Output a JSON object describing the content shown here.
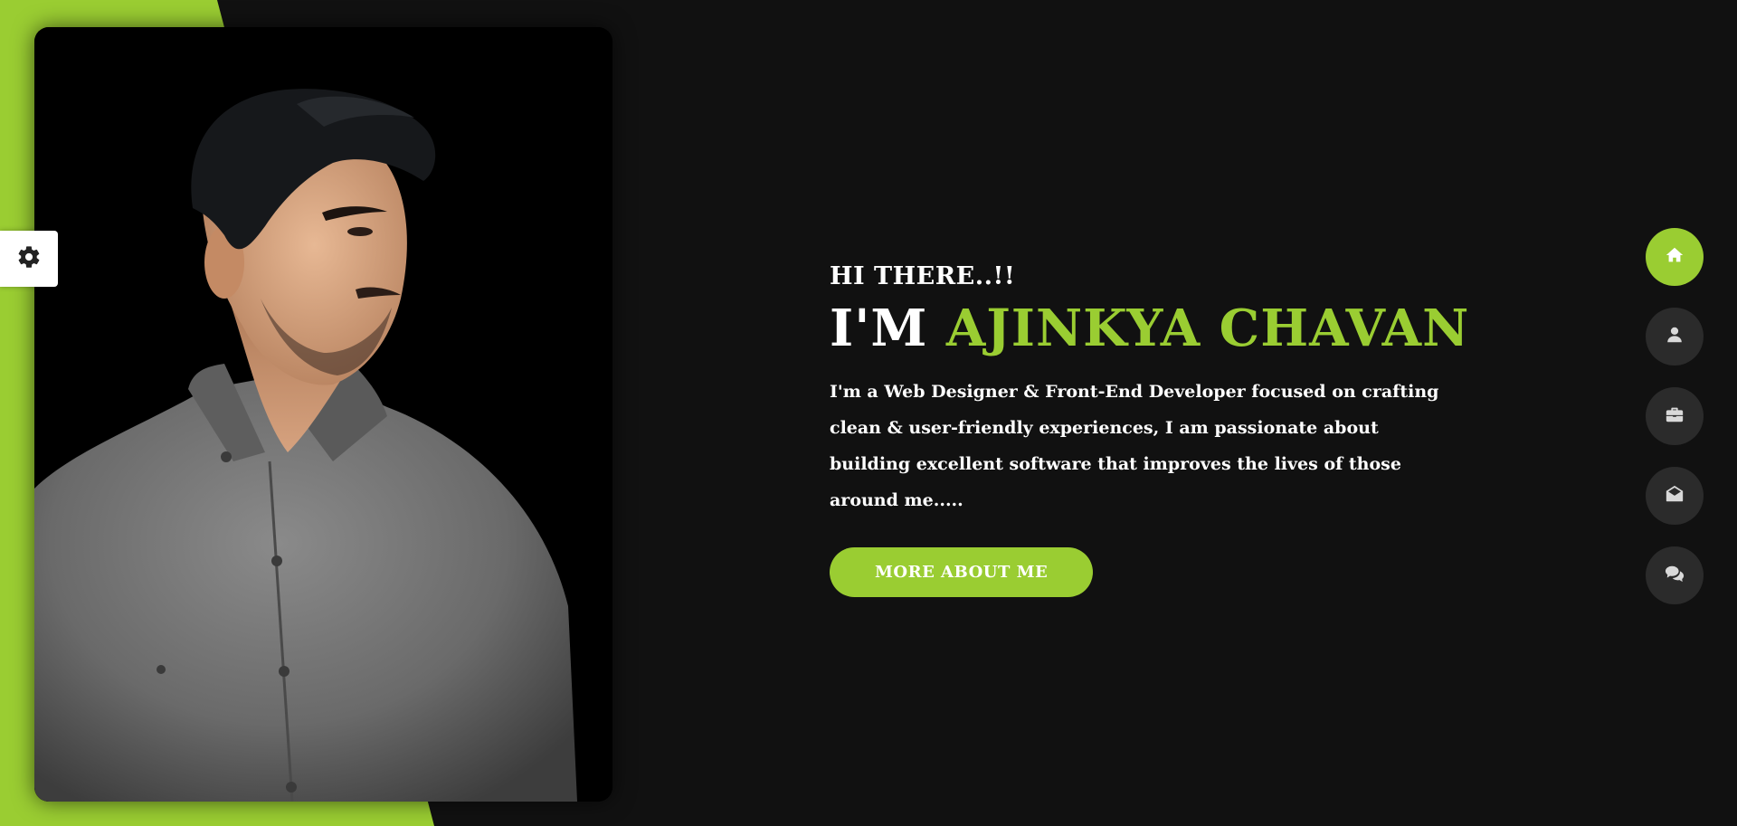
{
  "hero": {
    "greeting": "HI THERE..!!",
    "name_prefix": "I'M",
    "name": "AJINKYA CHAVAN",
    "intro": "I'm a Web Designer & Front-End Developer focused on crafting clean & user-friendly experiences, I am passionate about building excellent software that improves the lives of those around me.....",
    "cta_label": "MORE ABOUT ME"
  },
  "settings": {
    "icon": "gear-icon"
  },
  "side_nav": {
    "items": [
      {
        "icon": "home-icon",
        "active": true
      },
      {
        "icon": "user-icon",
        "active": false
      },
      {
        "icon": "briefcase-icon",
        "active": false
      },
      {
        "icon": "envelope-open-icon",
        "active": false
      },
      {
        "icon": "comments-icon",
        "active": false
      }
    ]
  },
  "colors": {
    "accent": "#9acd32",
    "background": "#111111",
    "nav_button": "#2b2b2b",
    "text": "#ffffff"
  }
}
